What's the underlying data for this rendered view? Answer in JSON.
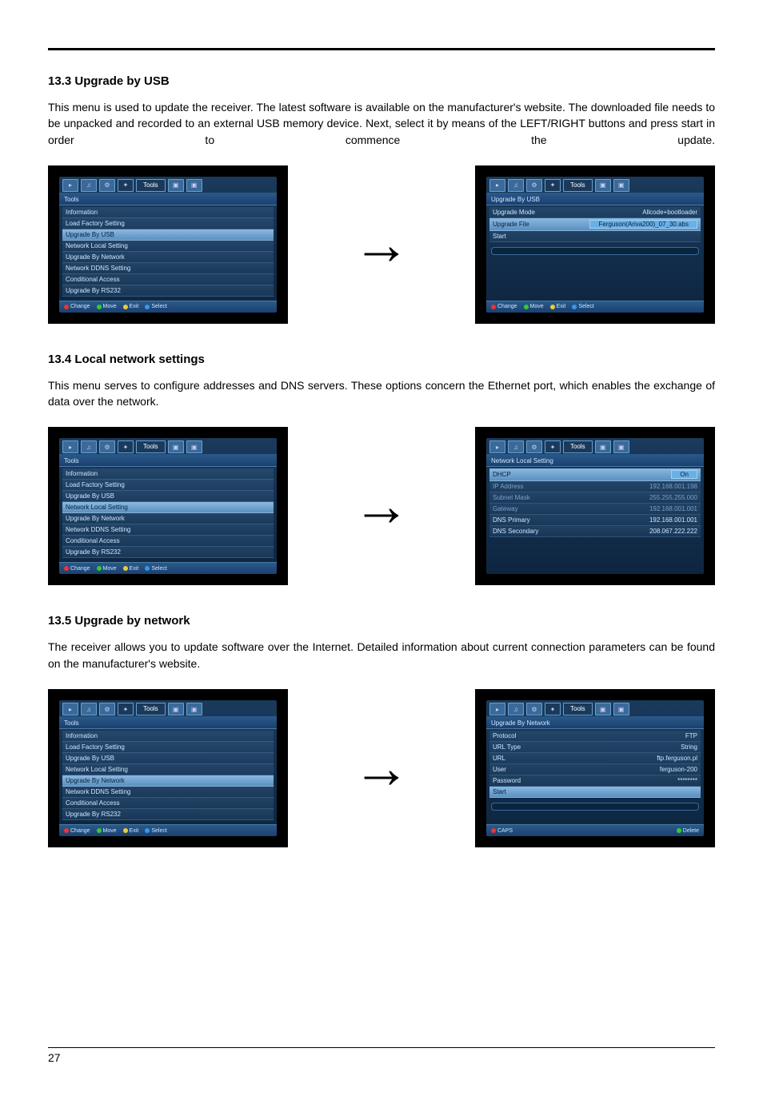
{
  "page_number": "27",
  "arrow_glyph": "→",
  "common_menu": {
    "tab_label": "Tools",
    "header": "Tools",
    "items": [
      "Information",
      "Load Factory Setting",
      "Upgrade By USB",
      "Network Local Setting",
      "Upgrade By Network",
      "Network DDNS Setting",
      "Conditional Access",
      "Upgrade By RS232"
    ],
    "footer": {
      "change": "Change",
      "move": "Move",
      "exit": "Exit",
      "select": "Select"
    }
  },
  "sec1": {
    "heading": "13.3 Upgrade by USB",
    "body": "This menu is used to update the receiver. The latest software is available on the manufacturer's website. The downloaded file needs to be unpacked and recorded to an external USB memory device. Next, select it by means of the LEFT/RIGHT buttons and press start in order to commence the update.",
    "left_highlight_index": 2,
    "right": {
      "header": "Upgrade By USB",
      "rows": [
        {
          "k": "Upgrade Mode",
          "v": "Allcode+bootloader",
          "hl": false,
          "pill": false
        },
        {
          "k": "Upgrade File",
          "v": "Ferguson(Ariva200)_07_30.abs",
          "hl": true,
          "pill": true
        },
        {
          "k": "Start",
          "v": "",
          "hl": false,
          "pill": false
        }
      ],
      "progress_pct": "0%"
    }
  },
  "sec2": {
    "heading": "13.4 Local network settings",
    "body": "This menu serves to configure addresses and DNS servers. These options concern the Ethernet port, which enables the exchange of data over the network.",
    "left_highlight_index": 3,
    "right": {
      "header": "Network Local Setting",
      "rows": [
        {
          "k": "DHCP",
          "v": "On",
          "hl": true,
          "dim": false,
          "pill": true
        },
        {
          "k": "IP Address",
          "v": "192.168.001.198",
          "hl": false,
          "dim": true
        },
        {
          "k": "Subnet Mask",
          "v": "255.255.255.000",
          "hl": false,
          "dim": true
        },
        {
          "k": "Gateway",
          "v": "192.168.001.001",
          "hl": false,
          "dim": true
        },
        {
          "k": "DNS Primary",
          "v": "192.168.001.001",
          "hl": false,
          "dim": false
        },
        {
          "k": "DNS Secondary",
          "v": "208.067.222.222",
          "hl": false,
          "dim": false
        }
      ]
    }
  },
  "sec3": {
    "heading": "13.5 Upgrade by network",
    "body": "The receiver allows you to update software over the Internet. Detailed information about current connection parameters can be found on the manufacturer's website.",
    "left_highlight_index": 4,
    "right": {
      "header": "Upgrade By Network",
      "rows": [
        {
          "k": "Protocol",
          "v": "FTP",
          "hl": false
        },
        {
          "k": "URL Type",
          "v": "String",
          "hl": false
        },
        {
          "k": "URL",
          "v": "ftp.ferguson.pl",
          "hl": false
        },
        {
          "k": "User",
          "v": "ferguson-200",
          "hl": false
        },
        {
          "k": "Password",
          "v": "********",
          "hl": false
        },
        {
          "k": "Start",
          "v": "",
          "hl": true
        }
      ],
      "progress_pct": "0%",
      "footer": {
        "caps": "CAPS",
        "delete": "Delete"
      }
    }
  }
}
